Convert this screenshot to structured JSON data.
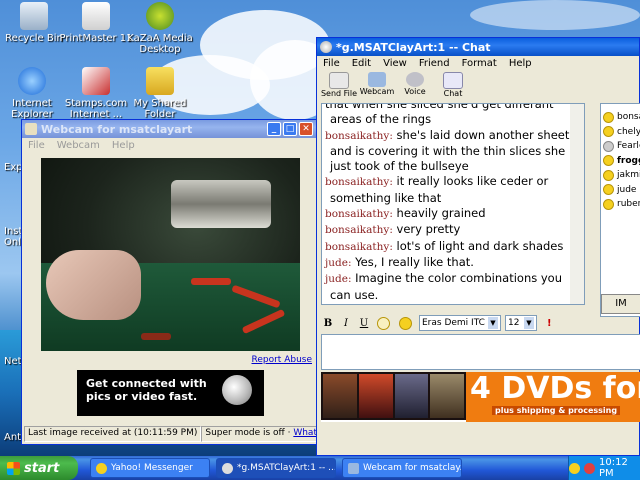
{
  "desktop": {
    "icons": [
      {
        "label": "Recycle Bin",
        "icon": "recycle-bin-icon"
      },
      {
        "label": "PrintMaster 11",
        "icon": "printmaster-icon"
      },
      {
        "label": "KaZaA Media Desktop",
        "icon": "kazaa-icon"
      },
      {
        "label": "Internet Explorer",
        "icon": "internet-explorer-icon"
      },
      {
        "label": "Stamps.com Internet ...",
        "icon": "stamps-icon"
      },
      {
        "label": "My Shared Folder",
        "icon": "shared-folder-icon"
      }
    ],
    "edge_labels": [
      "Exp",
      "Inst Onli",
      "Net",
      "Anti"
    ]
  },
  "webcam_window": {
    "title": "Webcam for msatclayart",
    "menu": [
      "File",
      "Webcam",
      "Help"
    ],
    "report_abuse": "Report Abuse",
    "ad_text_1": "Get connected with",
    "ad_text_2": "pics or video fast.",
    "status_last_image": "Last image received at (10:11:59 PM)",
    "status_super_mode": "Super mode is off · ",
    "status_whats_this": "What's this?"
  },
  "chat_window": {
    "title": "*g.MSATClayArt:1 -- Chat",
    "menu": [
      "File",
      "Edit",
      "View",
      "Friend",
      "Format",
      "Help"
    ],
    "toolbar": [
      "Send File",
      "Webcam",
      "Voice",
      "Chat"
    ],
    "partial_top": [
      "that when she sliced she'd get differant",
      "areas of the rings"
    ],
    "messages": [
      {
        "nick": "bonsaikathy:",
        "text": "she's laid down another sheet"
      },
      {
        "nick": "",
        "text": "and is covering it with the thin slices she"
      },
      {
        "nick": "",
        "text": "just took of the bullseye"
      },
      {
        "nick": "bonsaikathy:",
        "text": "it really looks like ceder or"
      },
      {
        "nick": "",
        "text": "something like that"
      },
      {
        "nick": "bonsaikathy:",
        "text": "heavily grained"
      },
      {
        "nick": "bonsaikathy:",
        "text": "very pretty"
      },
      {
        "nick": "bonsaikathy:",
        "text": "lot's of light and dark shades"
      },
      {
        "nick": "jude:",
        "text": "Yes, I really like that."
      },
      {
        "nick": "jude:",
        "text": "Imagine the color combinations you"
      },
      {
        "nick": "",
        "text": "can use."
      }
    ],
    "friends": [
      "bonsa",
      "chelyh",
      "Fearle",
      "frogg",
      "jakmia",
      "jude",
      "rubens"
    ],
    "im_button": "IM",
    "format": {
      "bold": "B",
      "italic": "I",
      "underline": "U",
      "font": "Eras Demi ITC",
      "size": "12"
    },
    "banner_text": "4 DVDs for",
    "banner_sub": "plus shipping & processing"
  },
  "taskbar": {
    "start": "start",
    "tasks": [
      "Yahoo! Messenger",
      "*g.MSATClayArt:1 -- ...",
      "Webcam for msatclay..."
    ],
    "clock": "10:12 PM"
  }
}
